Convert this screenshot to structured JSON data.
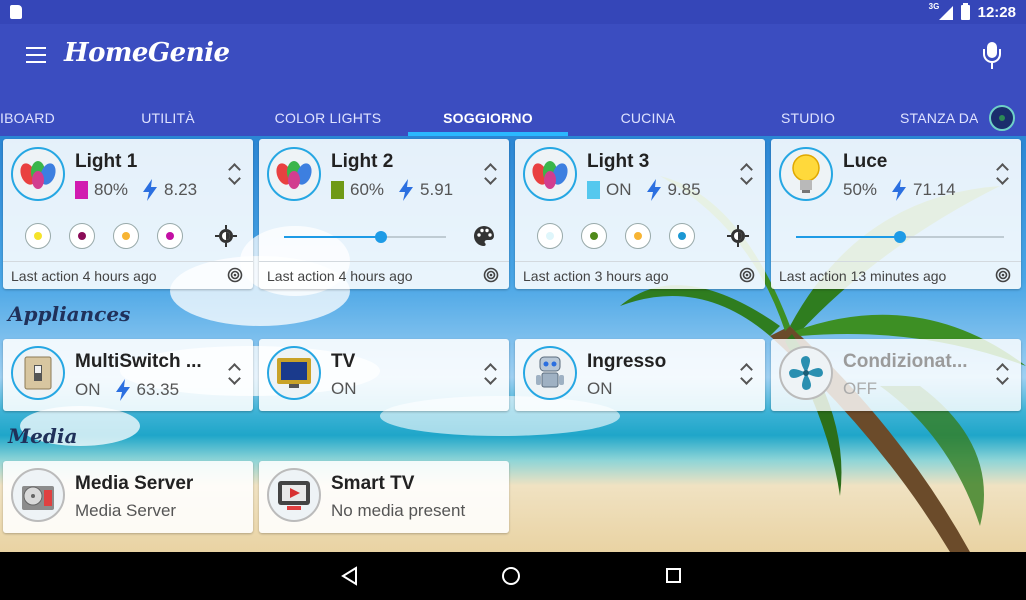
{
  "status_bar": {
    "network": "3G",
    "time": "12:28"
  },
  "app_bar": {
    "title": "HomeGenie"
  },
  "tabs": [
    {
      "label": "IBOARD",
      "active": false
    },
    {
      "label": "UTILITÀ",
      "active": false
    },
    {
      "label": "COLOR LIGHTS",
      "active": false
    },
    {
      "label": "SOGGIORNO",
      "active": true
    },
    {
      "label": "CUCINA",
      "active": false
    },
    {
      "label": "STUDIO",
      "active": false
    },
    {
      "label": "STANZA DA",
      "active": false
    }
  ],
  "colors": {
    "accent": "#26a7e3",
    "appbar": "#3b4dc0",
    "statusbar": "#3546b8",
    "tab_indicator": "#2ab7ff"
  },
  "lights": [
    {
      "name": "Light 1",
      "level": "80%",
      "swatch": "#d11bb0",
      "watts": "8.23",
      "icon": "color-bulbs-icon",
      "presets": [
        "#f5e32a",
        "#8a0b57",
        "#f7b433",
        "#c30fa4"
      ],
      "control": "gear",
      "last_action": "Last action 4 hours ago"
    },
    {
      "name": "Light 2",
      "level": "60%",
      "swatch": "#6f9a17",
      "watts": "5.91",
      "icon": "color-bulbs-icon",
      "slider": 0.6,
      "control": "palette",
      "last_action": "Last action 4 hours ago"
    },
    {
      "name": "Light 3",
      "level": "ON",
      "swatch": "#55c8ee",
      "watts": "9.85",
      "icon": "color-bulbs-icon",
      "presets": [
        "#dff6fb",
        "#4f8a1a",
        "#f7b433",
        "#1b97d3"
      ],
      "control": "gear",
      "last_action": "Last action 3 hours ago"
    },
    {
      "name": "Luce",
      "level": "50%",
      "swatch": "",
      "watts": "71.14",
      "icon": "light-bulb-icon",
      "slider": 0.5,
      "control": "none",
      "last_action": "Last action 13 minutes ago"
    }
  ],
  "sections": {
    "appliances": "Appliances",
    "media": "Media"
  },
  "appliances": [
    {
      "name": "MultiSwitch ...",
      "status": "ON",
      "watts": "63.35",
      "icon": "wall-switch-icon",
      "off": false
    },
    {
      "name": "TV",
      "status": "ON",
      "watts": "",
      "icon": "tv-icon",
      "off": false
    },
    {
      "name": "Ingresso",
      "status": "ON",
      "watts": "",
      "icon": "robot-icon",
      "off": false
    },
    {
      "name": "Condizionat...",
      "status": "OFF",
      "watts": "",
      "icon": "fan-icon",
      "off": true
    }
  ],
  "media": [
    {
      "name": "Media Server",
      "status": "Media Server",
      "icon": "media-server-icon"
    },
    {
      "name": "Smart TV",
      "status": "No media present",
      "icon": "smart-tv-icon"
    }
  ]
}
